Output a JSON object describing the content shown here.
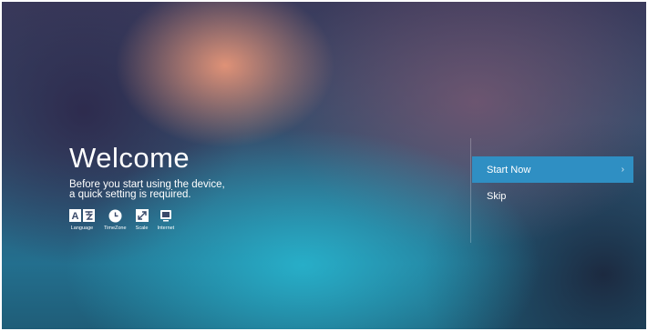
{
  "welcome": {
    "title": "Welcome",
    "subtitle_line1": "Before you start using the device,",
    "subtitle_line2": "a quick setting is required."
  },
  "steps": [
    {
      "label": "Language",
      "icon": "language-icon"
    },
    {
      "label": "TimeZone",
      "icon": "clock-icon"
    },
    {
      "label": "Scale",
      "icon": "scale-icon"
    },
    {
      "label": "Internet",
      "icon": "internet-icon"
    }
  ],
  "menu": {
    "start_label": "Start Now",
    "start_chevron": "›",
    "skip_label": "Skip"
  },
  "colors": {
    "accent": "#2f8fc3"
  }
}
